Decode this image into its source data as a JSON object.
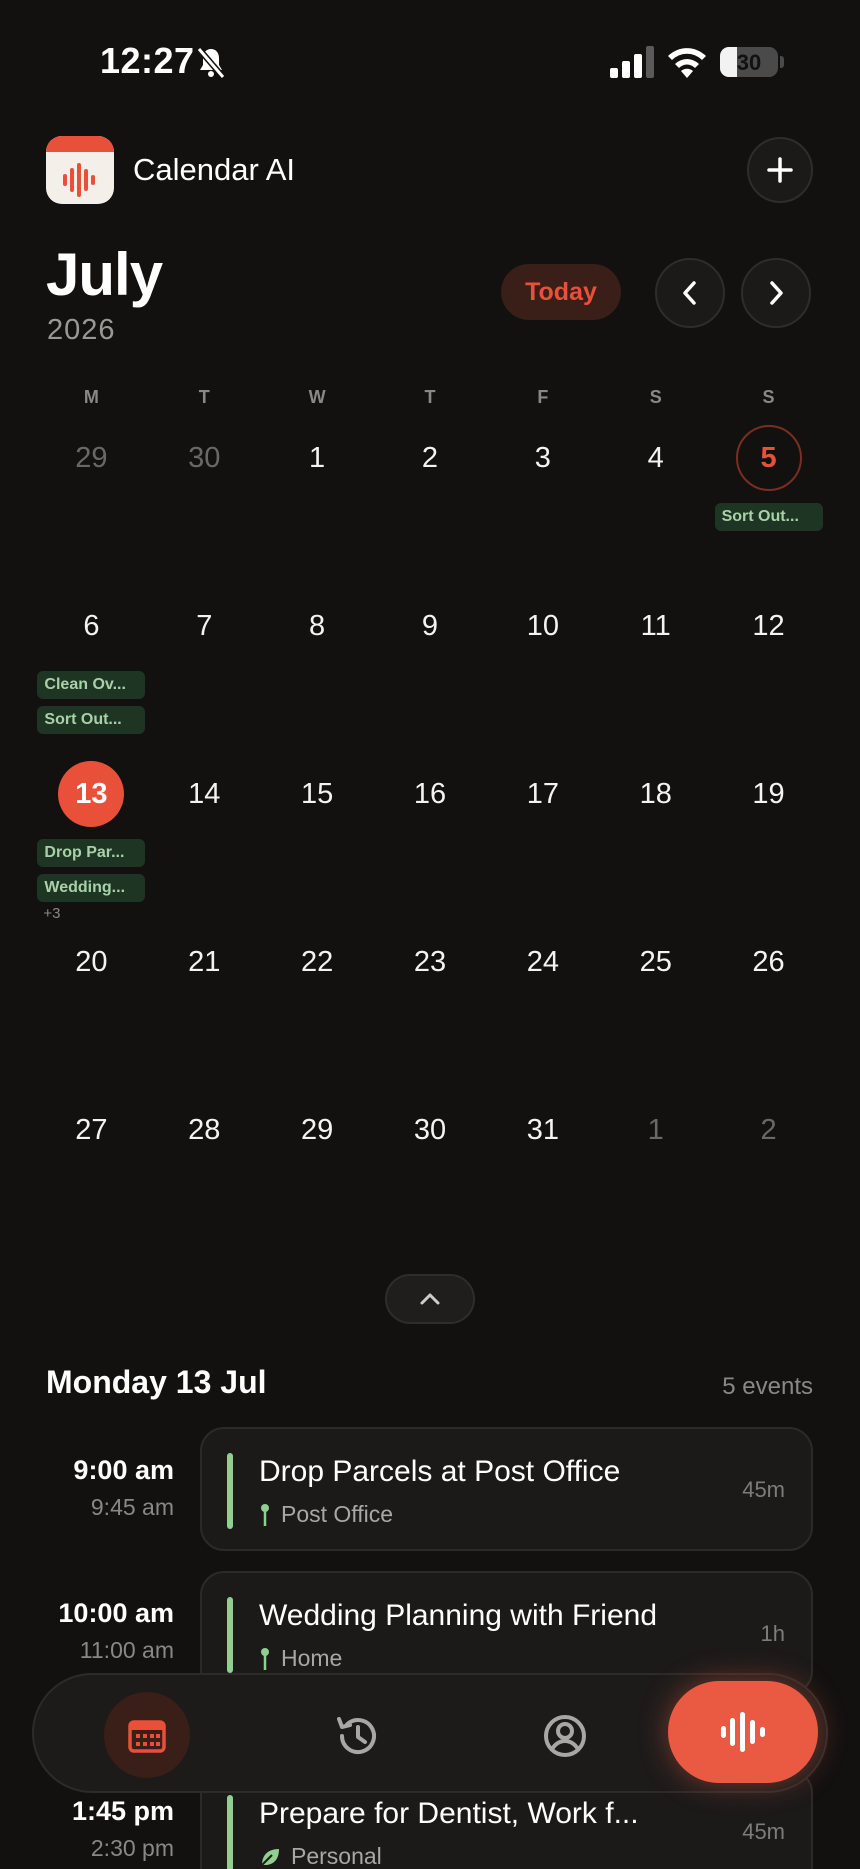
{
  "status_bar": {
    "time": "12:27",
    "battery": "30"
  },
  "header": {
    "app_name": "Calendar AI"
  },
  "month_nav": {
    "month": "July",
    "year": "2026",
    "today_label": "Today"
  },
  "weekdays": [
    "M",
    "T",
    "W",
    "T",
    "F",
    "S",
    "S"
  ],
  "calendar": {
    "weeks": [
      [
        {
          "d": "29",
          "muted": true
        },
        {
          "d": "30",
          "muted": true
        },
        {
          "d": "1"
        },
        {
          "d": "2"
        },
        {
          "d": "3"
        },
        {
          "d": "4"
        },
        {
          "d": "5",
          "ring": true,
          "chips": [
            "Sort Out..."
          ]
        }
      ],
      [
        {
          "d": "6",
          "chips": [
            "Clean Ov...",
            "Sort Out..."
          ]
        },
        {
          "d": "7"
        },
        {
          "d": "8"
        },
        {
          "d": "9"
        },
        {
          "d": "10"
        },
        {
          "d": "11"
        },
        {
          "d": "12"
        }
      ],
      [
        {
          "d": "13",
          "selected": true,
          "chips": [
            "Drop Par...",
            "Wedding..."
          ],
          "more": "+3"
        },
        {
          "d": "14"
        },
        {
          "d": "15"
        },
        {
          "d": "16"
        },
        {
          "d": "17"
        },
        {
          "d": "18"
        },
        {
          "d": "19"
        }
      ],
      [
        {
          "d": "20"
        },
        {
          "d": "21"
        },
        {
          "d": "22"
        },
        {
          "d": "23"
        },
        {
          "d": "24"
        },
        {
          "d": "25"
        },
        {
          "d": "26"
        }
      ],
      [
        {
          "d": "27"
        },
        {
          "d": "28"
        },
        {
          "d": "29"
        },
        {
          "d": "30"
        },
        {
          "d": "31"
        },
        {
          "d": "1",
          "muted": true
        },
        {
          "d": "2",
          "muted": true
        }
      ]
    ]
  },
  "day": {
    "title": "Monday 13 Jul",
    "count": "5 events"
  },
  "events": [
    {
      "start": "9:00 am",
      "end": "9:45 am",
      "title": "Drop Parcels at Post Office",
      "location": "Post Office",
      "loc_icon": "pin-icon",
      "duration": "45m"
    },
    {
      "start": "10:00 am",
      "end": "11:00 am",
      "title": "Wedding Planning with Friend",
      "location": "Home",
      "loc_icon": "pin-icon",
      "duration": "1h"
    },
    {
      "start": "1:45 pm",
      "end": "2:30 pm",
      "title": "Prepare for Dentist, Work f...",
      "location": "Personal",
      "loc_icon": "leaf-icon",
      "duration": "45m"
    }
  ],
  "bottom_nav": {
    "items": [
      "calendar-icon",
      "history-icon",
      "profile-icon",
      "voice-icon"
    ]
  },
  "colors": {
    "accent": "#e8503a",
    "event_green": "#8fcf8f",
    "chip_bg": "#1f3524",
    "background": "#121110"
  }
}
